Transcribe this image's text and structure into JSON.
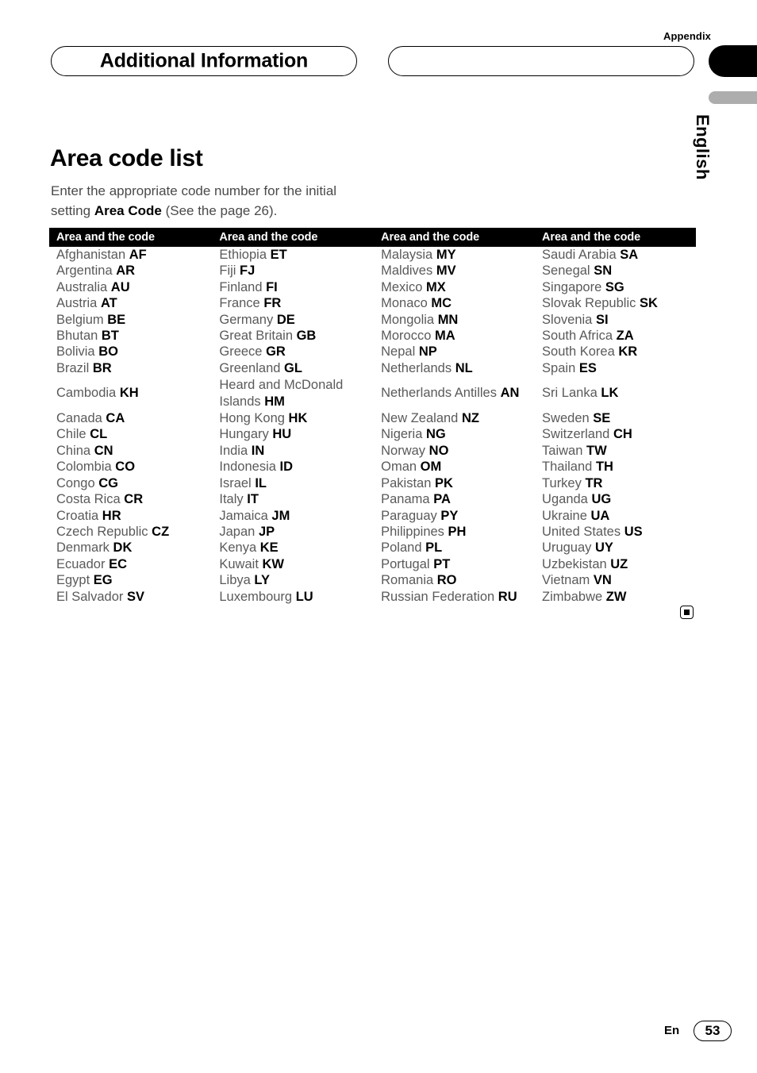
{
  "header": {
    "appendix_label": "Appendix",
    "section_title": "Additional Information",
    "empty_pill": "",
    "language_tab": "English"
  },
  "main": {
    "page_title": "Area code list",
    "intro_before": "Enter the appropriate code number for the initial setting ",
    "intro_bold": "Area Code",
    "intro_after": " (See the page 26)."
  },
  "table": {
    "headers": [
      "Area and the code",
      "Area and the code",
      "Area and the code",
      "Area and the code"
    ],
    "rows": [
      [
        {
          "name": "Afghanistan",
          "code": "AF"
        },
        {
          "name": "Ethiopia",
          "code": "ET"
        },
        {
          "name": "Malaysia",
          "code": "MY"
        },
        {
          "name": "Saudi Arabia",
          "code": "SA"
        }
      ],
      [
        {
          "name": "Argentina",
          "code": "AR"
        },
        {
          "name": "Fiji",
          "code": "FJ"
        },
        {
          "name": "Maldives",
          "code": "MV"
        },
        {
          "name": "Senegal",
          "code": "SN"
        }
      ],
      [
        {
          "name": "Australia",
          "code": "AU"
        },
        {
          "name": "Finland",
          "code": "FI"
        },
        {
          "name": "Mexico",
          "code": "MX"
        },
        {
          "name": "Singapore",
          "code": "SG"
        }
      ],
      [
        {
          "name": "Austria",
          "code": "AT"
        },
        {
          "name": "France",
          "code": "FR"
        },
        {
          "name": "Monaco",
          "code": "MC"
        },
        {
          "name": "Slovak Republic",
          "code": "SK"
        }
      ],
      [
        {
          "name": "Belgium",
          "code": "BE"
        },
        {
          "name": "Germany",
          "code": "DE"
        },
        {
          "name": "Mongolia",
          "code": "MN"
        },
        {
          "name": "Slovenia",
          "code": "SI"
        }
      ],
      [
        {
          "name": "Bhutan",
          "code": "BT"
        },
        {
          "name": "Great Britain",
          "code": "GB"
        },
        {
          "name": "Morocco",
          "code": "MA"
        },
        {
          "name": "South Africa",
          "code": "ZA"
        }
      ],
      [
        {
          "name": "Bolivia",
          "code": "BO"
        },
        {
          "name": "Greece",
          "code": "GR"
        },
        {
          "name": "Nepal",
          "code": "NP"
        },
        {
          "name": "South Korea",
          "code": "KR"
        }
      ],
      [
        {
          "name": "Brazil",
          "code": "BR"
        },
        {
          "name": "Greenland",
          "code": "GL"
        },
        {
          "name": "Netherlands",
          "code": "NL"
        },
        {
          "name": "Spain",
          "code": "ES"
        }
      ],
      [
        {
          "name": "Cambodia",
          "code": "KH"
        },
        {
          "name": "Heard and McDonald Islands",
          "code": "HM"
        },
        {
          "name": "Netherlands Antilles",
          "code": "AN"
        },
        {
          "name": "Sri Lanka",
          "code": "LK"
        }
      ],
      [
        {
          "name": "Canada",
          "code": "CA"
        },
        {
          "name": "Hong Kong",
          "code": "HK"
        },
        {
          "name": "New Zealand",
          "code": "NZ"
        },
        {
          "name": "Sweden",
          "code": "SE"
        }
      ],
      [
        {
          "name": "Chile",
          "code": "CL"
        },
        {
          "name": "Hungary",
          "code": "HU"
        },
        {
          "name": "Nigeria",
          "code": "NG"
        },
        {
          "name": "Switzerland",
          "code": "CH"
        }
      ],
      [
        {
          "name": "China",
          "code": "CN"
        },
        {
          "name": "India",
          "code": "IN"
        },
        {
          "name": "Norway",
          "code": "NO"
        },
        {
          "name": "Taiwan",
          "code": "TW"
        }
      ],
      [
        {
          "name": "Colombia",
          "code": "CO"
        },
        {
          "name": "Indonesia",
          "code": "ID"
        },
        {
          "name": "Oman",
          "code": "OM"
        },
        {
          "name": "Thailand",
          "code": "TH"
        }
      ],
      [
        {
          "name": "Congo",
          "code": "CG"
        },
        {
          "name": "Israel",
          "code": "IL"
        },
        {
          "name": "Pakistan",
          "code": "PK"
        },
        {
          "name": "Turkey",
          "code": "TR"
        }
      ],
      [
        {
          "name": "Costa Rica",
          "code": "CR"
        },
        {
          "name": "Italy",
          "code": "IT"
        },
        {
          "name": "Panama",
          "code": "PA"
        },
        {
          "name": "Uganda",
          "code": "UG"
        }
      ],
      [
        {
          "name": "Croatia",
          "code": "HR"
        },
        {
          "name": "Jamaica",
          "code": "JM"
        },
        {
          "name": "Paraguay",
          "code": "PY"
        },
        {
          "name": "Ukraine",
          "code": "UA"
        }
      ],
      [
        {
          "name": "Czech Republic",
          "code": "CZ"
        },
        {
          "name": "Japan",
          "code": "JP"
        },
        {
          "name": "Philippines",
          "code": "PH"
        },
        {
          "name": "United States",
          "code": "US"
        }
      ],
      [
        {
          "name": "Denmark",
          "code": "DK"
        },
        {
          "name": "Kenya",
          "code": "KE"
        },
        {
          "name": "Poland",
          "code": "PL"
        },
        {
          "name": "Uruguay",
          "code": "UY"
        }
      ],
      [
        {
          "name": "Ecuador",
          "code": "EC"
        },
        {
          "name": "Kuwait",
          "code": "KW"
        },
        {
          "name": "Portugal",
          "code": "PT"
        },
        {
          "name": "Uzbekistan",
          "code": "UZ"
        }
      ],
      [
        {
          "name": "Egypt",
          "code": "EG"
        },
        {
          "name": "Libya",
          "code": "LY"
        },
        {
          "name": "Romania",
          "code": "RO"
        },
        {
          "name": "Vietnam",
          "code": "VN"
        }
      ],
      [
        {
          "name": "El Salvador",
          "code": "SV"
        },
        {
          "name": "Luxembourg",
          "code": "LU"
        },
        {
          "name": "Russian Federation",
          "code": "RU"
        },
        {
          "name": "Zimbabwe",
          "code": "ZW"
        }
      ]
    ]
  },
  "footer": {
    "language_code": "En",
    "page_number": "53"
  },
  "colors": {
    "header_bar": "#000000",
    "body_text": "#5a5a5a",
    "code_text": "#000000",
    "gray_tab": "#adadad"
  }
}
